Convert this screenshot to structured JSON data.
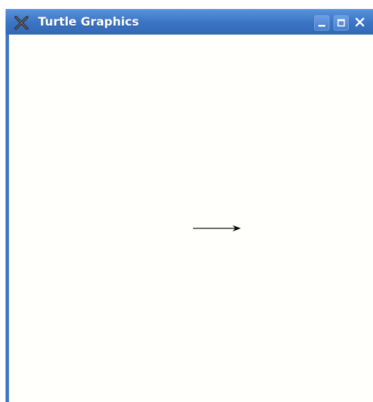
{
  "window": {
    "title": "Turtle Graphics",
    "icons": {
      "app": "x-app-icon",
      "minimize": "minimize-icon",
      "maximize": "maximize-icon",
      "close": "close-icon"
    },
    "colors": {
      "titlebar": "#3f77c6",
      "canvas_background": "#fffffb",
      "line": "#000000"
    }
  },
  "canvas": {
    "turtle_heading_degrees": 0
  }
}
